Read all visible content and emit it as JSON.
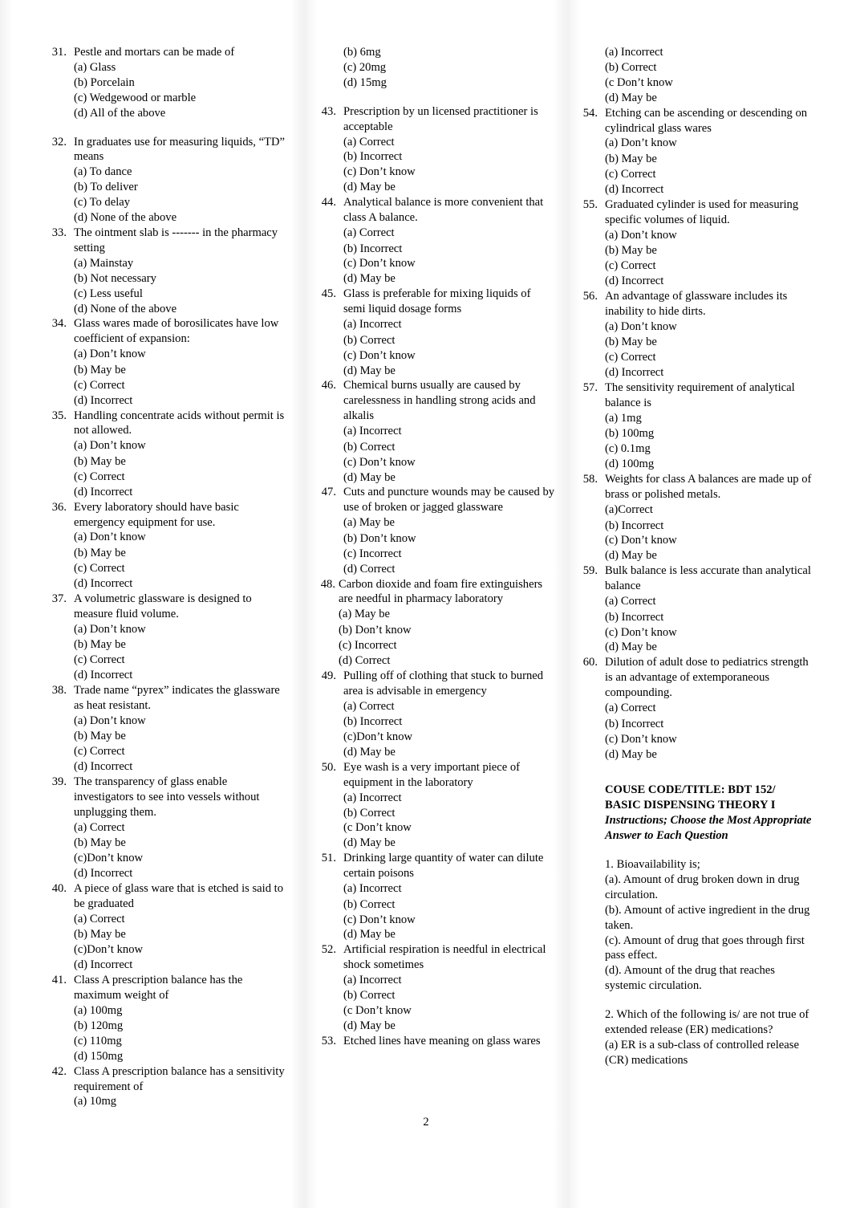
{
  "page": {
    "number": "2"
  },
  "columns": [
    {
      "id": "column-1",
      "blocks": [
        {
          "number": "31.",
          "stem": "Pestle and mortars can be made of",
          "options": [
            "(a) Glass",
            "(b) Porcelain",
            "(c) Wedgewood or marble",
            "(d) All of the above"
          ]
        },
        {
          "number": "32.",
          "stem": "In graduates use for measuring liquids, “TD” means",
          "options": [
            "(a) To dance",
            "(b) To deliver",
            "(c) To delay",
            "(d) None of the above"
          ]
        },
        {
          "number": "33.",
          "stem": "The ointment slab is ------- in the pharmacy setting",
          "options": [
            "(a) Mainstay",
            "(b) Not necessary",
            "(c) Less useful",
            "(d) None of the above"
          ]
        },
        {
          "number": "34.",
          "stem": "Glass wares made of borosilicates have low coefficient of expansion:",
          "options": [
            "(a) Don’t know",
            "(b) May be",
            "(c) Correct",
            "(d) Incorrect"
          ]
        },
        {
          "number": "35.",
          "stem": "Handling concentrate acids without permit is not allowed.",
          "options": [
            "(a) Don’t know",
            "(b) May be",
            "(c) Correct",
            "(d) Incorrect"
          ]
        },
        {
          "number": "36.",
          "stem": "Every laboratory should have basic emergency equipment for use.",
          "options": [
            "(a) Don’t know",
            "(b) May be",
            "(c) Correct",
            "(d) Incorrect"
          ]
        },
        {
          "number": "37.",
          "stem": "A  volumetric glassware is designed to measure fluid volume.",
          "options": [
            "(a) Don’t know",
            "(b) May be",
            "(c) Correct",
            "(d) Incorrect"
          ]
        },
        {
          "number": "38.",
          "stem": "Trade name “pyrex” indicates the glassware as heat resistant.",
          "options": [
            "(a) Don’t know",
            "(b) May be",
            "(c) Correct",
            "(d) Incorrect"
          ]
        },
        {
          "number": "39.",
          "stem": "The transparency of glass enable investigators to see into vessels without unplugging them.",
          "options": [
            "(a) Correct",
            "(b) May be",
            "(c)Don’t know",
            "(d) Incorrect"
          ]
        },
        {
          "number": "40.",
          "stem": "A piece of glass ware that is etched is said to be graduated",
          "options": [
            "(a) Correct",
            "(b) May be",
            "(c)Don’t know",
            "(d) Incorrect"
          ]
        },
        {
          "number": "41.",
          "stem": "Class A prescription balance has the maximum weight of",
          "options": [
            "(a) 100mg",
            "(b) 120mg",
            "(c) 110mg",
            "(d) 150mg"
          ]
        },
        {
          "number": "42.",
          "stem": "Class A prescription balance has a sensitivity requirement of",
          "options": [
            "(a) 10mg"
          ]
        }
      ]
    },
    {
      "id": "column-2",
      "continued_options": [
        "(b) 6mg",
        "(c) 20mg",
        "(d) 15mg"
      ],
      "blocks": [
        {
          "number": "43.",
          "stem": "Prescription by un licensed practitioner is acceptable",
          "options": [
            "(a) Correct",
            "(b) Incorrect",
            "(c) Don’t know",
            "(d) May be"
          ]
        },
        {
          "number": "44.",
          "stem": "Analytical balance is more convenient that class A balance.",
          "options": [
            "(a) Correct",
            "(b) Incorrect",
            "(c) Don’t know",
            "(d) May be"
          ]
        },
        {
          "number": "45.",
          "stem": "Glass is preferable for mixing liquids of semi liquid dosage forms",
          "options": [
            "(a) Incorrect",
            "(b) Correct",
            "(c) Don’t know",
            "(d) May be"
          ]
        },
        {
          "number": "46.",
          "stem": "Chemical burns usually are caused by carelessness in handling strong acids and alkalis",
          "options": [
            "(a) Incorrect",
            "(b) Correct",
            "(c) Don’t know",
            "(d) May be"
          ]
        },
        {
          "number": "47.",
          "stem": "Cuts and puncture wounds may be caused by use of broken or jagged glassware",
          "options": [
            "(a) May be",
            "(b) Don’t know",
            "(c) Incorrect",
            "(d) Correct"
          ]
        },
        {
          "number": "48.",
          "stem": "Carbon dioxide and foam fire extinguishers are needful in pharmacy laboratory",
          "options": [
            "(a) May be",
            "(b) Don’t know",
            "(c) Incorrect",
            "(d) Correct"
          ]
        },
        {
          "number": "49.",
          "stem": "Pulling off of clothing that stuck to burned area is  advisable in emergency",
          "options": [
            "(a) Correct",
            "(b) Incorrect",
            "(c)Don’t know",
            "(d) May be"
          ]
        },
        {
          "number": "50.",
          "stem": "Eye wash is a very important piece of equipment in the laboratory",
          "options": [
            "(a) Incorrect",
            "(b) Correct",
            "(c Don’t know",
            "(d) May be"
          ]
        },
        {
          "number": "51.",
          "stem": "Drinking large quantity of water can dilute certain poisons",
          "options": [
            "(a) Incorrect",
            "(b) Correct",
            "(c) Don’t know",
            "(d) May be"
          ]
        },
        {
          "number": "52.",
          "stem": "Artificial respiration is needful in electrical shock sometimes",
          "options": [
            "(a) Incorrect",
            "(b) Correct",
            "(c Don’t know",
            "(d) May be"
          ]
        },
        {
          "number": "53.",
          "stem": "Etched lines have meaning on glass wares",
          "options": []
        }
      ]
    },
    {
      "id": "column-3",
      "continued_options": [
        "(a) Incorrect",
        "(b) Correct",
        "(c Don’t know",
        "(d) May be"
      ],
      "blocks": [
        {
          "number": "54.",
          "stem": "Etching can be ascending or descending on cylindrical glass wares",
          "options": [
            "(a) Don’t know",
            "(b) May be",
            "(c) Correct",
            "(d) Incorrect"
          ]
        },
        {
          "number": "55.",
          "stem": "Graduated cylinder is used for measuring specific volumes of liquid.",
          "options": [
            "(a) Don’t know",
            "(b) May be",
            "(c) Correct",
            "(d) Incorrect"
          ]
        },
        {
          "number": "56.",
          "stem": "An advantage of glassware includes its inability to hide dirts.",
          "options": [
            "(a) Don’t know",
            "(b) May be",
            "(c) Correct",
            "(d) Incorrect"
          ]
        },
        {
          "number": "57.",
          "stem": "The sensitivity requirement of analytical balance is",
          "options": [
            "(a) 1mg",
            "(b) 100mg",
            "(c) 0.1mg",
            "(d) 100mg"
          ]
        },
        {
          "number": "58.",
          "stem": "Weights for class A balances are made up of brass or polished metals.",
          "options": [
            "(a)Correct",
            "(b) Incorrect",
            "(c) Don’t know",
            "(d) May be"
          ]
        },
        {
          "number": "59.",
          "stem": "Bulk balance is less accurate than analytical balance",
          "options": [
            "(a) Correct",
            "(b) Incorrect",
            "(c) Don’t know",
            "(d) May be"
          ]
        },
        {
          "number": "60.",
          "stem": "Dilution of adult dose to pediatrics strength is an advantage of extemporaneous compounding.",
          "options": [
            "(a) Correct",
            "(b) Incorrect",
            "(c) Don’t know",
            "(d) May be"
          ]
        }
      ],
      "section": {
        "course_line_1": "COUSE CODE/TITLE: BDT 152/",
        "course_line_2": "BASIC DISPENSING THEORY I",
        "instructions": "Instructions; Choose the Most Appropriate Answer to Each Question",
        "items": [
          {
            "stem": "1. Bioavailability is;",
            "options": [
              "(a). Amount of drug broken down in drug circulation.",
              "(b). Amount of active ingredient in the drug taken.",
              "(c). Amount of drug that goes through first pass effect.",
              "(d). Amount of the drug that reaches systemic circulation."
            ]
          },
          {
            "stem": "2.  Which of the following is/ are not true of extended release (ER) medications?",
            "options": [
              "(a) ER is a sub-class of controlled release (CR) medications"
            ]
          }
        ]
      }
    }
  ]
}
